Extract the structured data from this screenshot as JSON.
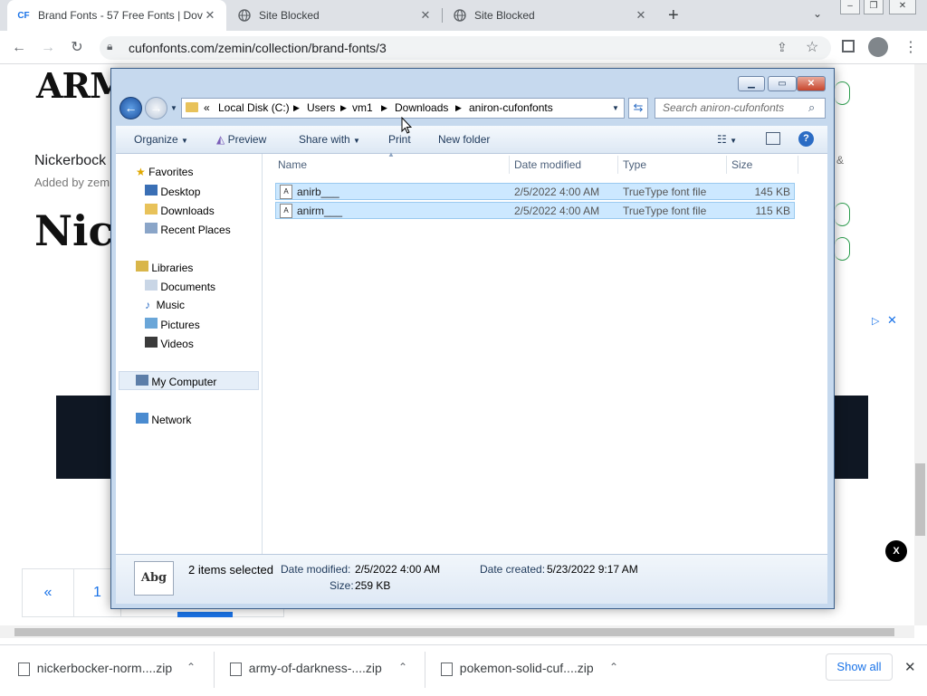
{
  "browser": {
    "tabs": [
      {
        "favicon": "CF",
        "title": "Brand Fonts - 57 Free Fonts | Dov",
        "active": true
      },
      {
        "favicon": "globe-icon",
        "title": "Site Blocked",
        "active": false
      },
      {
        "favicon": "globe-icon",
        "title": "Site Blocked",
        "active": false
      }
    ],
    "url": "cufonfonts.com/zemin/collection/brand-fonts/3"
  },
  "webpage": {
    "army_heading": "ARMY",
    "nick_title": "Nickerbock",
    "added_by": "Added by zem",
    "nick_sample": "Nicke",
    "ad_close": "X",
    "pager": [
      "«",
      "1"
    ],
    "ampersand": "&"
  },
  "explorer": {
    "breadcrumb": [
      "«",
      "Local Disk (C:)",
      "Users",
      "vm1",
      "Downloads",
      "aniron-cufonfonts"
    ],
    "search_placeholder": "Search aniron-cufonfonts",
    "commands": [
      "Organize",
      "Preview",
      "Share with",
      "Print",
      "New folder"
    ],
    "nav": {
      "favorites": {
        "label": "Favorites",
        "items": [
          "Desktop",
          "Downloads",
          "Recent Places"
        ]
      },
      "libraries": {
        "label": "Libraries",
        "items": [
          "Documents",
          "Music",
          "Pictures",
          "Videos"
        ]
      },
      "computer": "My Computer",
      "network": "Network"
    },
    "columns": [
      "Name",
      "Date modified",
      "Type",
      "Size"
    ],
    "files": [
      {
        "name": "anirb___",
        "date": "2/5/2022 4:00 AM",
        "type": "TrueType font file",
        "size": "145 KB"
      },
      {
        "name": "anirm___",
        "date": "2/5/2022 4:00 AM",
        "type": "TrueType font file",
        "size": "115 KB"
      }
    ],
    "details": {
      "icon_text": "Abg",
      "selected": "2 items selected",
      "date_modified_label": "Date modified:",
      "date_modified": "2/5/2022 4:00 AM",
      "date_created_label": "Date created:",
      "date_created": "5/23/2022 9:17 AM",
      "size_label": "Size:",
      "size": "259 KB"
    }
  },
  "downloads": {
    "items": [
      "nickerbocker-norm....zip",
      "army-of-darkness-....zip",
      "pokemon-solid-cuf....zip"
    ],
    "show_all": "Show all"
  }
}
